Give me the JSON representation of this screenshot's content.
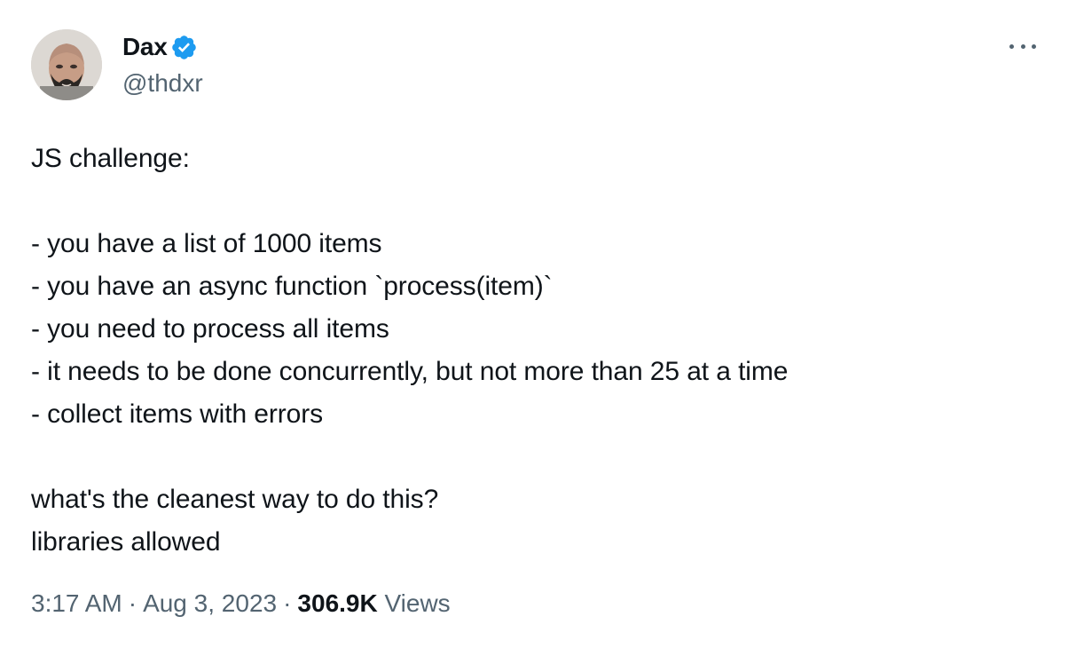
{
  "author": {
    "name": "Dax",
    "handle": "@thdxr",
    "verified_color": "#1d9bf0"
  },
  "tweet": {
    "lines": [
      "JS challenge:",
      "",
      "- you have a list of 1000 items",
      "- you have an async function `process(item)`",
      "- you need to process all items",
      "- it needs to be done concurrently, but not more than 25 at a time",
      "- collect items with errors",
      "",
      "what's the cleanest way to do this?",
      "libraries allowed"
    ]
  },
  "meta": {
    "time": "3:17 AM",
    "separator": "·",
    "date": "Aug 3, 2023",
    "views_count": "306.9K",
    "views_label": "Views"
  },
  "icons": {
    "more": "more-horizontal-icon",
    "verified": "verified-badge-icon"
  }
}
